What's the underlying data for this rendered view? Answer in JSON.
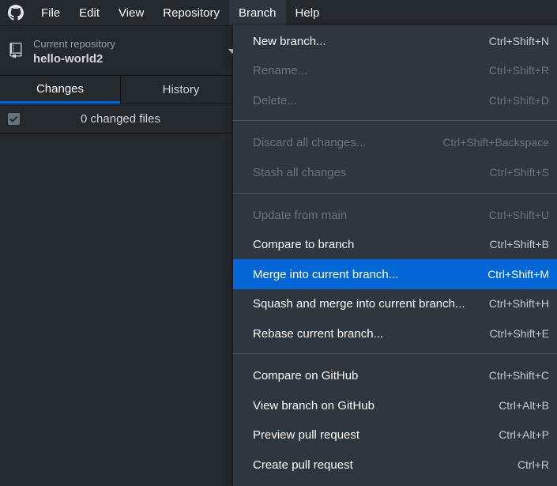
{
  "menubar": {
    "logo_icon": "github-octocat-icon",
    "items": [
      "File",
      "Edit",
      "View",
      "Repository",
      "Branch",
      "Help"
    ],
    "open_menu": "Branch"
  },
  "repository": {
    "caption": "Current repository",
    "name": "hello-world2"
  },
  "tabs": {
    "changes": "Changes",
    "history": "History",
    "active": "Changes"
  },
  "changes": {
    "count_label": "0 changed files",
    "checkbox_checked": true
  },
  "branch_menu": {
    "highlighted": "Merge into current branch...",
    "accent_color": "#0366d6",
    "groups": [
      [
        {
          "label": "New branch...",
          "shortcut": "Ctrl+Shift+N",
          "enabled": true
        },
        {
          "label": "Rename...",
          "shortcut": "Ctrl+Shift+R",
          "enabled": false
        },
        {
          "label": "Delete...",
          "shortcut": "Ctrl+Shift+D",
          "enabled": false
        }
      ],
      [
        {
          "label": "Discard all changes...",
          "shortcut": "Ctrl+Shift+Backspace",
          "enabled": false
        },
        {
          "label": "Stash all changes",
          "shortcut": "Ctrl+Shift+S",
          "enabled": false
        }
      ],
      [
        {
          "label": "Update from main",
          "shortcut": "Ctrl+Shift+U",
          "enabled": false
        },
        {
          "label": "Compare to branch",
          "shortcut": "Ctrl+Shift+B",
          "enabled": true
        },
        {
          "label": "Merge into current branch...",
          "shortcut": "Ctrl+Shift+M",
          "enabled": true
        },
        {
          "label": "Squash and merge into current branch...",
          "shortcut": "Ctrl+Shift+H",
          "enabled": true
        },
        {
          "label": "Rebase current branch...",
          "shortcut": "Ctrl+Shift+E",
          "enabled": true
        }
      ],
      [
        {
          "label": "Compare on GitHub",
          "shortcut": "Ctrl+Shift+C",
          "enabled": true
        },
        {
          "label": "View branch on GitHub",
          "shortcut": "Ctrl+Alt+B",
          "enabled": true
        },
        {
          "label": "Preview pull request",
          "shortcut": "Ctrl+Alt+P",
          "enabled": true
        },
        {
          "label": "Create pull request",
          "shortcut": "Ctrl+R",
          "enabled": true
        }
      ]
    ]
  }
}
